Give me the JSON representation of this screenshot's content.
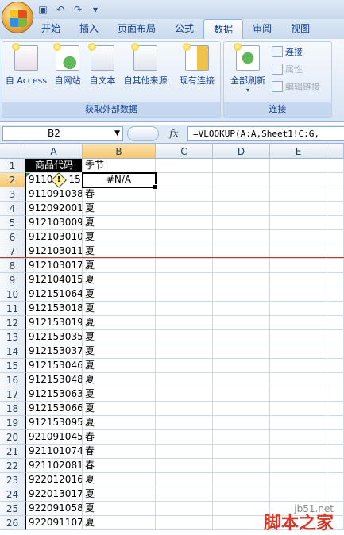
{
  "qat": {
    "save_icon": "save-icon",
    "undo_icon": "undo-icon",
    "redo_icon": "redo-icon",
    "more_icon": "customize-icon"
  },
  "tabs": [
    {
      "label": "开始",
      "active": false
    },
    {
      "label": "插入",
      "active": false
    },
    {
      "label": "页面布局",
      "active": false
    },
    {
      "label": "公式",
      "active": false
    },
    {
      "label": "数据",
      "active": true
    },
    {
      "label": "审阅",
      "active": false
    },
    {
      "label": "视图",
      "active": false
    }
  ],
  "ribbon": {
    "external": {
      "buttons": [
        "自 Access",
        "自网站",
        "自文本",
        "自其他来源",
        "现有连接"
      ],
      "label": "获取外部数据"
    },
    "connections": {
      "refresh_label": "全部刷新",
      "items": [
        "连接",
        "属性",
        "编辑链接"
      ],
      "label": "连接"
    }
  },
  "formula_bar": {
    "name_box": "B2",
    "fx": "fx",
    "formula": "=VLOOKUP(A:A,Sheet1!C:G,"
  },
  "sheet": {
    "columns": [
      "A",
      "B",
      "C",
      "D",
      "E"
    ],
    "selected_column": "B",
    "selected_row": "2",
    "rows": [
      {
        "n": "1",
        "a": "商品代码",
        "b": "季节"
      },
      {
        "n": "2",
        "a": "9110",
        "b": "#N/A",
        "a_tail": "15"
      },
      {
        "n": "3",
        "a": "911091038",
        "b": "春"
      },
      {
        "n": "4",
        "a": "912092001",
        "b": "夏"
      },
      {
        "n": "5",
        "a": "912103009",
        "b": "夏"
      },
      {
        "n": "6",
        "a": "912103010",
        "b": "夏"
      },
      {
        "n": "7",
        "a": "912103011",
        "b": "夏"
      },
      {
        "n": "8",
        "a": "912103017",
        "b": "夏"
      },
      {
        "n": "9",
        "a": "912104015",
        "b": "夏"
      },
      {
        "n": "10",
        "a": "912151064",
        "b": "夏"
      },
      {
        "n": "11",
        "a": "912153018",
        "b": "夏"
      },
      {
        "n": "12",
        "a": "912153019",
        "b": "夏"
      },
      {
        "n": "13",
        "a": "912153035",
        "b": "夏"
      },
      {
        "n": "14",
        "a": "912153037",
        "b": "夏"
      },
      {
        "n": "15",
        "a": "912153046",
        "b": "夏"
      },
      {
        "n": "16",
        "a": "912153048",
        "b": "夏"
      },
      {
        "n": "17",
        "a": "912153063",
        "b": "夏"
      },
      {
        "n": "18",
        "a": "912153066",
        "b": "夏"
      },
      {
        "n": "19",
        "a": "912153095",
        "b": "夏"
      },
      {
        "n": "20",
        "a": "921091045",
        "b": "春"
      },
      {
        "n": "21",
        "a": "921101074",
        "b": "春"
      },
      {
        "n": "22",
        "a": "921102081",
        "b": "春"
      },
      {
        "n": "23",
        "a": "922012016",
        "b": "夏"
      },
      {
        "n": "24",
        "a": "922013017",
        "b": "夏"
      },
      {
        "n": "25",
        "a": "922091058",
        "b": "夏"
      },
      {
        "n": "26",
        "a": "922091107",
        "b": "夏"
      }
    ]
  },
  "watermark": {
    "site": "jb51.net",
    "brand": "脚本之家"
  }
}
